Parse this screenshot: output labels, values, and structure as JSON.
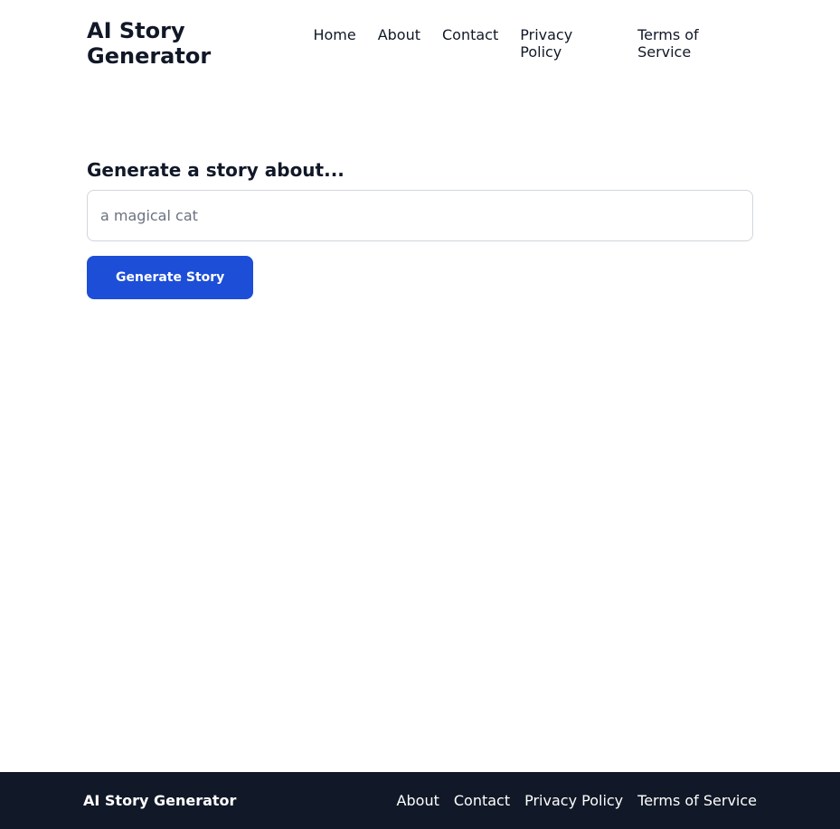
{
  "header": {
    "brand": "AI Story Generator",
    "nav": {
      "home": "Home",
      "about": "About",
      "contact": "Contact",
      "privacy": "Privacy Policy",
      "terms": "Terms of Service"
    }
  },
  "main": {
    "prompt_label": "Generate a story about...",
    "input_placeholder": "a magical cat",
    "input_value": "",
    "button_label": "Generate Story"
  },
  "footer": {
    "brand": "AI Story Generator",
    "nav": {
      "about": "About",
      "contact": "Contact",
      "privacy": "Privacy Policy",
      "terms": "Terms of Service"
    }
  },
  "colors": {
    "primary": "#1d4ed8",
    "text": "#111827",
    "border": "#d1d5db",
    "footer_bg": "#111827"
  }
}
